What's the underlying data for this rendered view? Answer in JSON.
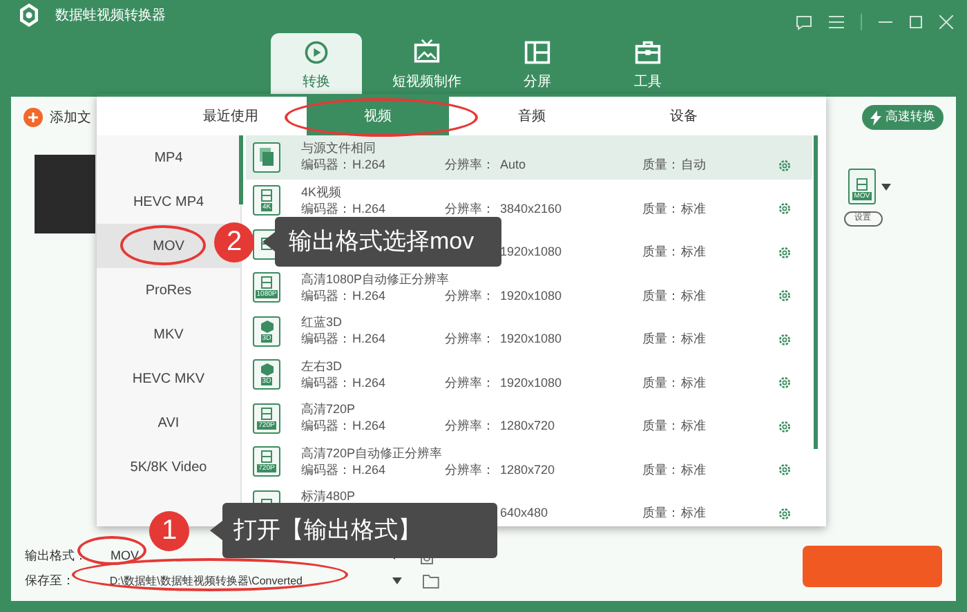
{
  "window": {
    "title": "数据蛙视频转换器"
  },
  "main_tabs": [
    {
      "label": "转换",
      "selected": true
    },
    {
      "label": "短视频制作",
      "selected": false
    },
    {
      "label": "分屏",
      "selected": false
    },
    {
      "label": "工具",
      "selected": false
    }
  ],
  "toolbar": {
    "add_file": "添加文",
    "fast_convert": "高速转换"
  },
  "format_panel": {
    "tabs": [
      {
        "label": "最近使用",
        "selected": false
      },
      {
        "label": "视频",
        "selected": true
      },
      {
        "label": "音频",
        "selected": false
      },
      {
        "label": "设备",
        "selected": false
      }
    ],
    "formats": [
      {
        "label": "MP4",
        "selected": false
      },
      {
        "label": "HEVC MP4",
        "selected": false
      },
      {
        "label": "MOV",
        "selected": true
      },
      {
        "label": "ProRes",
        "selected": false
      },
      {
        "label": "MKV",
        "selected": false
      },
      {
        "label": "HEVC MKV",
        "selected": false
      },
      {
        "label": "AVI",
        "selected": false
      },
      {
        "label": "5K/8K Video",
        "selected": false
      }
    ],
    "presets": [
      {
        "kind": "source",
        "name": "与源文件相同",
        "codec_label": "编码器：",
        "codec": "H.264",
        "resolution_label": "分辨率：",
        "resolution": "Auto",
        "quality_label": "质量：",
        "quality": "自动",
        "selected": true
      },
      {
        "kind": "film",
        "badge": "4K",
        "name": "4K视频",
        "codec_label": "编码器：",
        "codec": "H.264",
        "resolution_label": "分辨率：",
        "resolution": "3840x2160",
        "quality_label": "质量：",
        "quality": "标准",
        "selected": false
      },
      {
        "kind": "film",
        "resolution": "1920x1080",
        "quality_label": "质量：",
        "quality": "标准",
        "selected": false
      },
      {
        "kind": "film",
        "badge": "1080P",
        "name": "高清1080P自动修正分辨率",
        "codec_label": "编码器：",
        "codec": "H.264",
        "resolution_label": "分辨率：",
        "resolution": "1920x1080",
        "quality_label": "质量：",
        "quality": "标准",
        "selected": false
      },
      {
        "kind": "cube",
        "badge": "3D",
        "name": "红蓝3D",
        "codec_label": "编码器：",
        "codec": "H.264",
        "resolution_label": "分辨率：",
        "resolution": "1920x1080",
        "quality_label": "质量：",
        "quality": "标准",
        "selected": false
      },
      {
        "kind": "cube",
        "badge": "3D",
        "name": "左右3D",
        "codec_label": "编码器：",
        "codec": "H.264",
        "resolution_label": "分辨率：",
        "resolution": "1920x1080",
        "quality_label": "质量：",
        "quality": "标准",
        "selected": false
      },
      {
        "kind": "film",
        "badge": "720P",
        "name": "高清720P",
        "codec_label": "编码器：",
        "codec": "H.264",
        "resolution_label": "分辨率：",
        "resolution": "1280x720",
        "quality_label": "质量：",
        "quality": "标准",
        "selected": false
      },
      {
        "kind": "film",
        "badge": "720P",
        "name": "高清720P自动修正分辨率",
        "codec_label": "编码器：",
        "codec": "H.264",
        "resolution_label": "分辨率：",
        "resolution": "1280x720",
        "quality_label": "质量：",
        "quality": "标准",
        "selected": false
      },
      {
        "kind": "film",
        "name": "标清480P",
        "resolution": "640x480",
        "quality_label": "质量：",
        "quality": "标准",
        "selected": false
      }
    ]
  },
  "output_preview": {
    "format_badge": "MOV",
    "settings": "设置"
  },
  "bottom_bar": {
    "format_label": "输出格式：",
    "format": "MOV",
    "save_label": "保存至：",
    "save_path": "D:\\数据蛙\\数据蛙视频转换器\\Converted"
  },
  "annotations": [
    {
      "number": "2",
      "text": "输出格式选择mov"
    },
    {
      "number": "1",
      "text": "打开【输出格式】"
    }
  ]
}
